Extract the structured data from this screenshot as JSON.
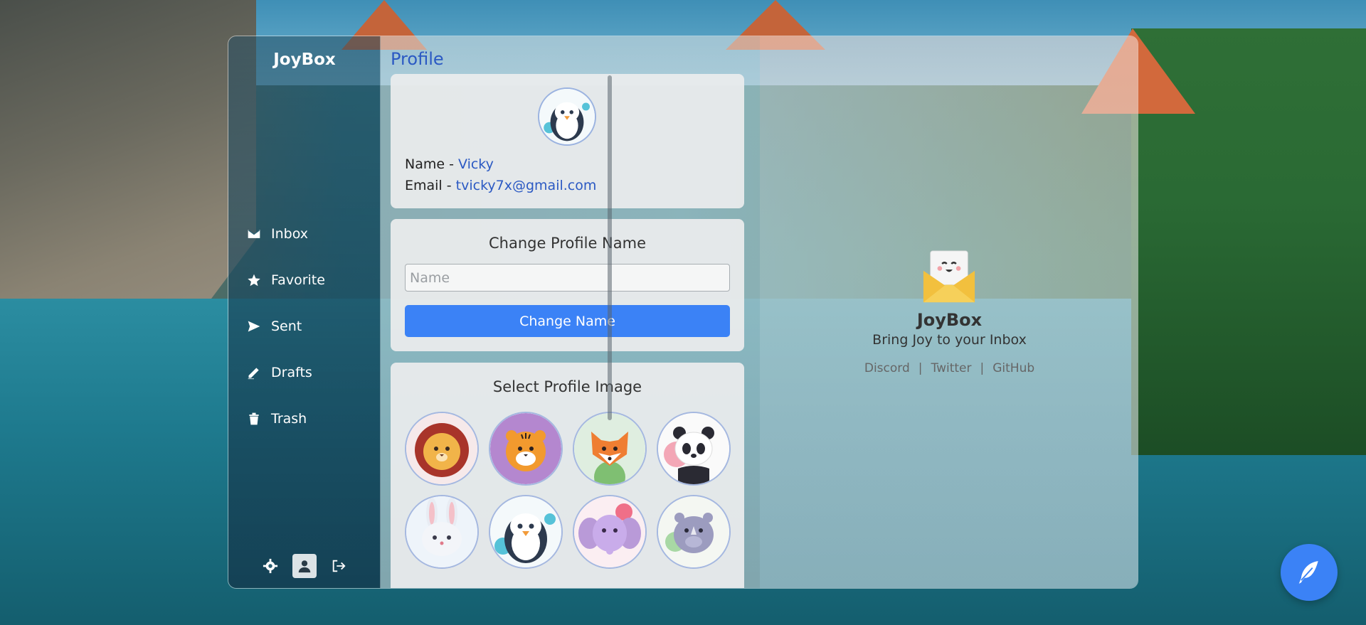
{
  "sidebar": {
    "brand": "JoyBox",
    "items": [
      {
        "label": "Inbox",
        "icon": "envelope-icon"
      },
      {
        "label": "Favorite",
        "icon": "star-icon"
      },
      {
        "label": "Sent",
        "icon": "send-icon"
      },
      {
        "label": "Drafts",
        "icon": "pencil-icon"
      },
      {
        "label": "Trash",
        "icon": "trash-icon"
      }
    ],
    "footer": [
      "gear-icon",
      "user-icon",
      "logout-icon"
    ]
  },
  "profile": {
    "page_title": "Profile",
    "name_label": "Name - ",
    "name_value": "Vicky",
    "email_label": "Email - ",
    "email_value": "tvicky7x@gmail.com",
    "change_name_title": "Change Profile Name",
    "name_placeholder": "Name",
    "change_name_button": "Change Name",
    "select_image_title": "Select Profile Image",
    "avatars": [
      "lion",
      "tiger",
      "fox",
      "panda",
      "rabbit",
      "penguin",
      "elephant",
      "rhino"
    ]
  },
  "welcome": {
    "brand": "JoyBox",
    "tagline": "Bring Joy to your Inbox",
    "links": [
      "Discord",
      "Twitter",
      "GitHub"
    ],
    "separator": "|"
  },
  "colors": {
    "accent": "#3b82f6",
    "link": "#2b59c3"
  }
}
